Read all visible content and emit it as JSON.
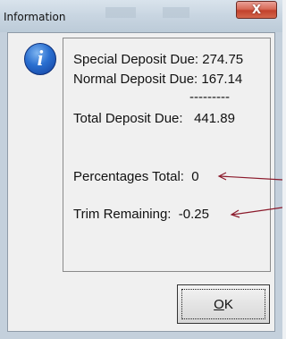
{
  "window": {
    "title": "Information",
    "close_glyph": "X",
    "accent_close": "#c8412c"
  },
  "icon": {
    "name": "information-icon",
    "glyph": "i"
  },
  "message": {
    "special_deposit": "Special Deposit Due: 274.75",
    "normal_deposit": "Normal Deposit Due: 167.14",
    "separator": "---------",
    "total_deposit": "Total Deposit Due:   441.89",
    "percentages_total": "Percentages Total:  0",
    "trim_remaining": "Trim Remaining:  -0.25"
  },
  "buttons": {
    "ok_mnemonic": "O",
    "ok_rest": "K"
  },
  "colors": {
    "arrow": "#8b1a2b",
    "info_icon": "#2a6fd0"
  }
}
